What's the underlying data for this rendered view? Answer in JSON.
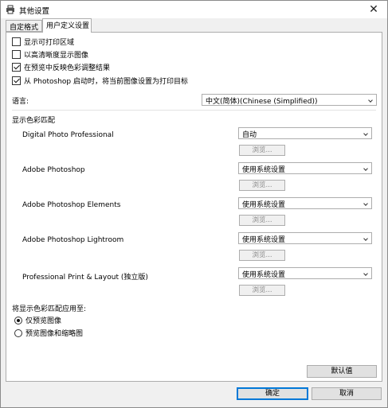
{
  "window": {
    "title": "其他设置",
    "close_label": "✕"
  },
  "tabs": [
    {
      "label": "自定格式"
    },
    {
      "label": "用户定义设置"
    }
  ],
  "checkboxes": [
    {
      "label": "显示可打印区域",
      "checked": false
    },
    {
      "label": "以高清晰度显示图像",
      "checked": false
    },
    {
      "label": "在预览中反映色彩调整结果",
      "checked": true
    },
    {
      "label": "从 Photoshop 启动时，将当前图像设置为打印目标",
      "checked": true
    }
  ],
  "language": {
    "label": "语言:",
    "value": "中文(简体)(Chinese (Simplified))"
  },
  "color_matching": {
    "heading": "显示色彩匹配",
    "apps": [
      {
        "name": "Digital Photo Professional",
        "value": "自动",
        "browse": "浏览..."
      },
      {
        "name": "Adobe Photoshop",
        "value": "使用系统设置",
        "browse": "浏览..."
      },
      {
        "name": "Adobe Photoshop Elements",
        "value": "使用系统设置",
        "browse": "浏览..."
      },
      {
        "name": "Adobe Photoshop Lightroom",
        "value": "使用系统设置",
        "browse": "浏览..."
      },
      {
        "name": "Professional Print & Layout (独立版)",
        "value": "使用系统设置",
        "browse": "浏览..."
      }
    ]
  },
  "apply_to": {
    "heading": "将显示色彩匹配应用至:",
    "options": [
      {
        "label": "仅预览图像",
        "selected": true
      },
      {
        "label": "预览图像和缩略图",
        "selected": false
      }
    ]
  },
  "buttons": {
    "defaults": "默认值",
    "ok": "确定",
    "cancel": "取消"
  }
}
